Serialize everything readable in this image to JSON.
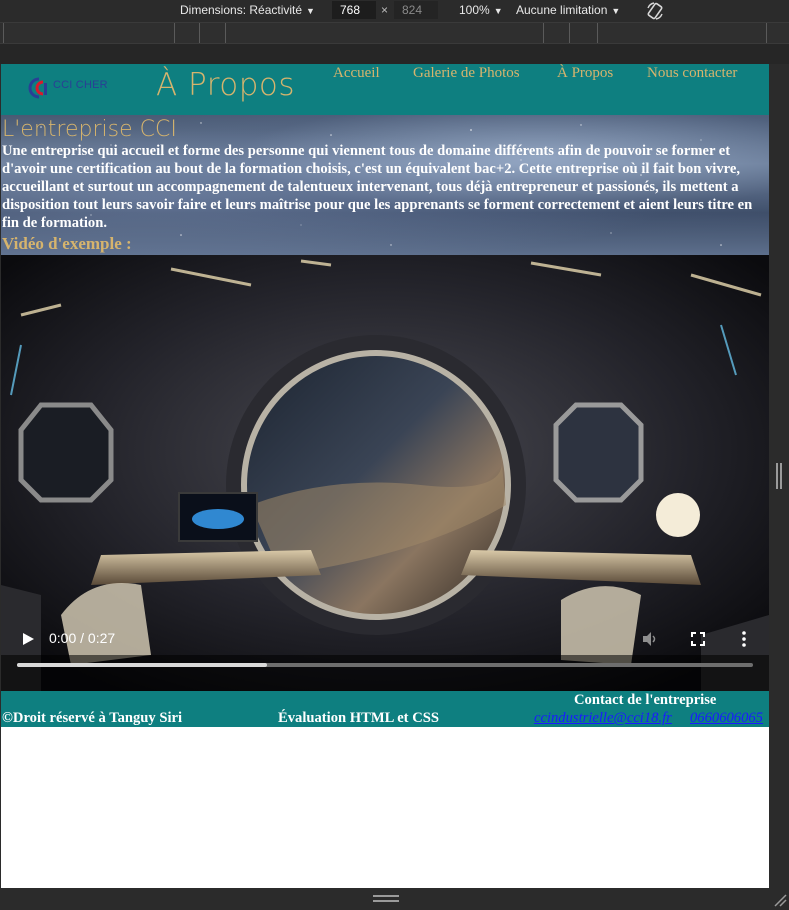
{
  "devtools": {
    "dimensions_label": "Dimensions: Réactivité",
    "width_value": "768",
    "times": "×",
    "height_value": "824",
    "zoom": "100%",
    "throttle": "Aucune limitation",
    "rotate_icon": "rotate-icon"
  },
  "site": {
    "logo_text": "CCI CHER",
    "page_title": "À Propos",
    "nav": [
      "Accueil",
      "Galerie de Photos",
      "À Propos",
      "Nous contacter"
    ],
    "section_title": "L'entreprise CCI",
    "intro": "Une entreprise qui accueil et forme des personne qui viennent tous de domaine différents afin de pouvoir se former et d'avoir une certification au bout de la formation choisis, c'est un équivalent bac+2. Cette entreprise où il fait bon vivre, accueillant et surtout un accompagnement de talentueux intervenant, tous déjà entrepreneur et passionés, ils mettent a disposition tout leurs savoir faire et leurs maîtrise pour que les apprenants se forment correctement et aient leurs titre en fin de formation.",
    "video_heading": "Vidéo d'exemple :",
    "video": {
      "time": "0:00 / 0:27",
      "buffered_fraction": 0.34
    },
    "footer": {
      "copyright": "©Droit réservé à Tanguy Siri",
      "evaluation": "Évaluation HTML et CSS",
      "contact_title": "Contact de l'entreprise",
      "email": "ccindustrielle@cci18.fr",
      "phone": "0660606065"
    }
  },
  "colors": {
    "header_teal": "#0e7f80",
    "gold": "#d6b46d",
    "link_blue": "#1a1aff"
  }
}
